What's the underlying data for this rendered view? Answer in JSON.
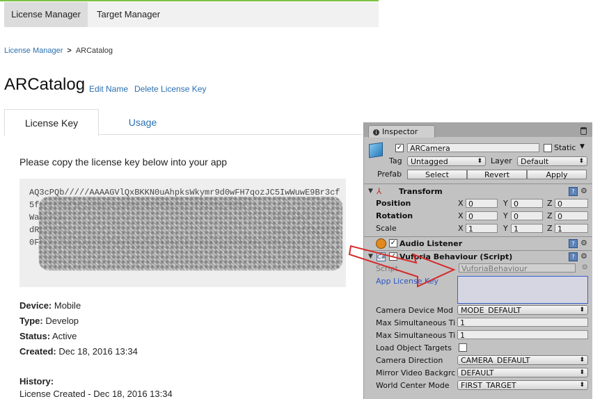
{
  "nav": {
    "tabs": [
      {
        "label": "License Manager",
        "active": true
      },
      {
        "label": "Target Manager",
        "active": false
      }
    ]
  },
  "breadcrumb": {
    "root": "License Manager",
    "separator": ">",
    "current": "ARCatalog"
  },
  "page": {
    "title": "ARCatalog",
    "edit_name": "Edit Name",
    "delete_license_key": "Delete License Key",
    "tabs": [
      {
        "label": "License Key"
      },
      {
        "label": "Usage"
      }
    ],
    "copy_instruction": "Please copy the license key below into your app",
    "license_key_visible": "AQ3cPQb/////AAAAGVlQxBKKN0uAhpksWkymr9d0wFH7qozJC5IwWuwE9Br3cf5fzc1M3hPBtSOKNK9sQ3AEs4fMW1k0OFiftIyb73H6N                                         Wa64rXu                                         t28TIJrh                                         dRmIe14                                         1IiXihqx3gglmr0Fn0/s3yU+5yyoJMC8w0q+wEKSkbAQLNsRK1VijNRVVSQFT5mbj7qxIJ",
    "details": [
      {
        "label": "Device:",
        "value": "Mobile"
      },
      {
        "label": "Type:",
        "value": "Develop"
      },
      {
        "label": "Status:",
        "value": "Active"
      },
      {
        "label": "Created:",
        "value": "Dec 18, 2016 13:34"
      }
    ],
    "history_label": "History:",
    "history_entry": "License Created - Dec 18, 2016 13:34"
  },
  "inspector": {
    "tab_label": "Inspector",
    "object_name": "ARCamera",
    "static_label": "Static",
    "tag_label": "Tag",
    "tag_value": "Untagged",
    "layer_label": "Layer",
    "layer_value": "Default",
    "prefab_label": "Prefab",
    "prefab_buttons": [
      "Select",
      "Revert",
      "Apply"
    ],
    "transform": {
      "title": "Transform",
      "rows": [
        {
          "label": "Position",
          "x": "0",
          "y": "0",
          "z": "0"
        },
        {
          "label": "Rotation",
          "x": "0",
          "y": "0",
          "z": "0"
        },
        {
          "label": "Scale",
          "x": "1",
          "y": "1",
          "z": "1"
        }
      ],
      "axis_labels": [
        "X",
        "Y",
        "Z"
      ]
    },
    "audio_listener": {
      "title": "Audio Listener"
    },
    "vuforia": {
      "title": "Vuforia Behaviour (Script)",
      "script_label": "Script",
      "script_value": "VuforiaBehaviour",
      "app_license_key_label": "App License Key",
      "app_license_key_value": "",
      "fields": [
        {
          "label": "Camera Device Mod",
          "value": "MODE_DEFAULT",
          "kind": "dropdown"
        },
        {
          "label": "Max Simultaneous Ti",
          "value": "1",
          "kind": "text"
        },
        {
          "label": "Max Simultaneous Ti",
          "value": "1",
          "kind": "text"
        },
        {
          "label": "Load Object Targets",
          "value": "",
          "kind": "checkbox"
        },
        {
          "label": "Camera Direction",
          "value": "CAMERA_DEFAULT",
          "kind": "dropdown"
        },
        {
          "label": "Mirror Video Backgrc",
          "value": "DEFAULT",
          "kind": "dropdown"
        },
        {
          "label": "World Center Mode",
          "value": "FIRST_TARGET",
          "kind": "dropdown"
        }
      ]
    }
  },
  "colors": {
    "accent_green": "#7cc242",
    "link_blue": "#2a6fb0",
    "arrow_red": "#d62a2a",
    "inspector_bg": "#c2c2c2"
  }
}
